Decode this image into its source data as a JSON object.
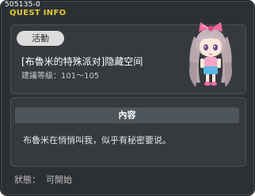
{
  "window": {
    "quest_id": "505135-0",
    "title": "QUEST INFO"
  },
  "quest": {
    "category": "活動",
    "name": "[布魯米的特殊派对]隐藏空间",
    "level_range": "建議等級：101～105",
    "npc_icon": "npc-portrait-pink-bow-girl-icon"
  },
  "content": {
    "header": "內容",
    "description": "布魯米在悄悄叫我，似乎有秘密要说。"
  },
  "status": {
    "label": "狀態：",
    "value": "可開始"
  },
  "colors": {
    "window_bg": "#2d3033",
    "panel_bg": "#363a3e",
    "title_yellow": "#e0c83a",
    "tag_bg": "#dcdcdc",
    "header_bg": "#4e555b"
  }
}
